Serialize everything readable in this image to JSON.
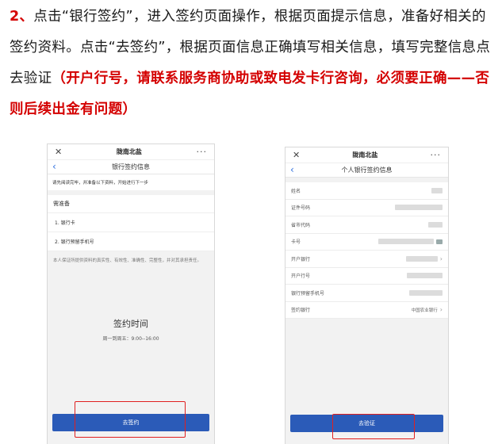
{
  "instructions": {
    "step_number": "2、",
    "main_text": "点击“银行签约”，进入签约页面操作，根据页面提示信息，准备好相关的签约资料。点击“去签约”，根据页面信息正确填写相关信息，填写完整信息点去验证",
    "warning_text": "（开户行号，请联系服务商协助或致电发卡行咨询，必须要正确——否则后续出金有问题）"
  },
  "left_phone": {
    "close_glyph": "✕",
    "app_title": "陇南北盐",
    "more_glyph": "···",
    "back_glyph": "‹",
    "page_title": "银行签约信息",
    "notice": "请先阅读完毕，并准备以下资料，开始进行下一步",
    "section_title": "需准备",
    "requirements": [
      "1.   银行卡",
      "2.   银行预留手机号"
    ],
    "disclaimer": "本人保证所提供资料的真实性、有效性、准确性、完整性，并对其承担责任。",
    "sign_time_title": "签约时间",
    "sign_time_hours": "周一到周五：9:00--16:00",
    "button_label": "去签约"
  },
  "right_phone": {
    "close_glyph": "✕",
    "app_title": "陇南北盐",
    "more_glyph": "···",
    "back_glyph": "‹",
    "page_title": "个人银行签约信息",
    "fields": [
      {
        "label": "姓名"
      },
      {
        "label": "证件号码"
      },
      {
        "label": "省市代码"
      },
      {
        "label": "卡号"
      },
      {
        "label": "开户银行"
      },
      {
        "label": "开户行号"
      },
      {
        "label": "银行预留手机号"
      },
      {
        "label": "签约银行",
        "value": "中国农业银行"
      }
    ],
    "chevron_glyph": "›",
    "button_label": "去验证"
  },
  "colors": {
    "warning_red": "#d40000",
    "button_blue": "#2b5bb8",
    "back_blue": "#2f6fde",
    "highlight_red": "#e02020"
  }
}
